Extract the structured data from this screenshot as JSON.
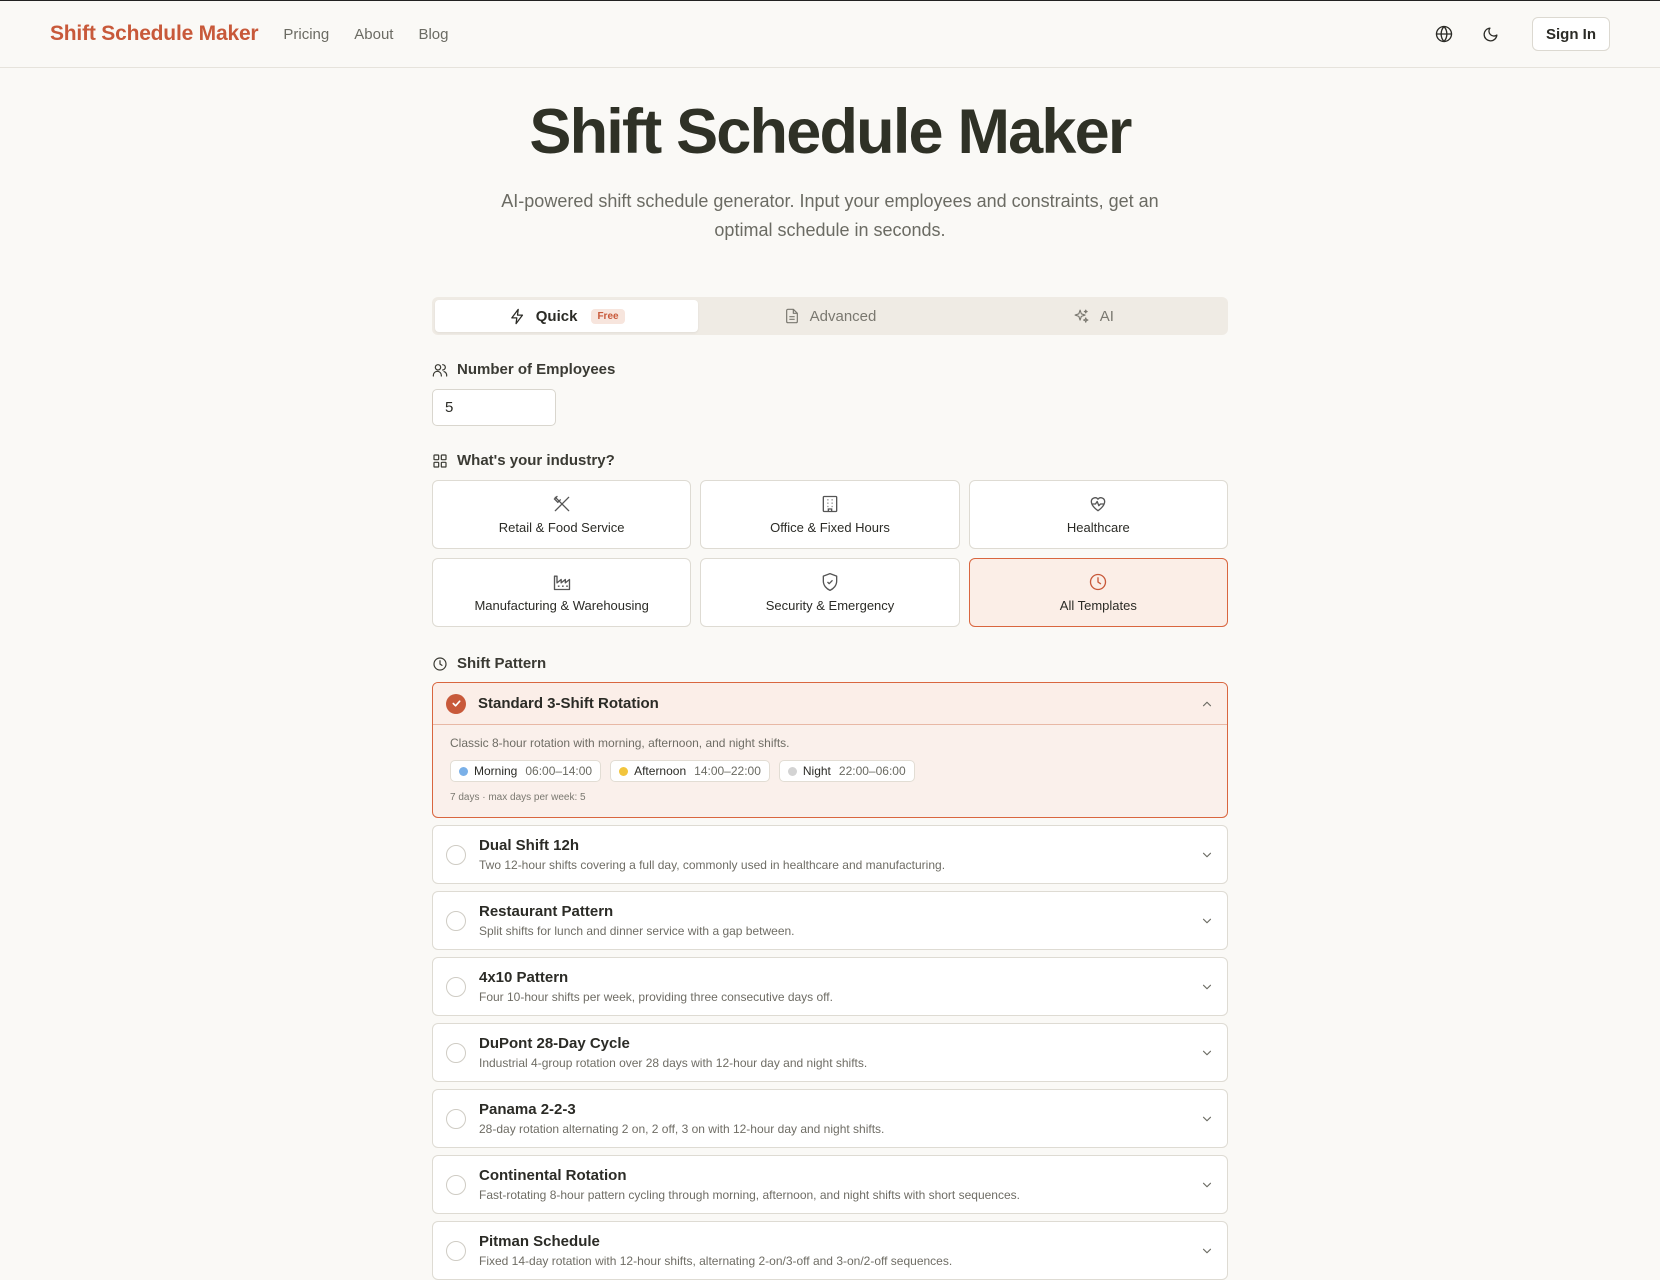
{
  "header": {
    "brand": "Shift Schedule Maker",
    "nav": [
      "Pricing",
      "About",
      "Blog"
    ],
    "sign_in": "Sign In"
  },
  "hero": {
    "title": "Shift Schedule Maker",
    "subtitle": "AI-powered shift schedule generator. Input your employees and constraints, get an optimal schedule in seconds."
  },
  "tabs": {
    "quick": "Quick",
    "free_badge": "Free",
    "advanced": "Advanced",
    "ai": "AI"
  },
  "employees": {
    "label": "Number of Employees",
    "value": "5"
  },
  "industry": {
    "label": "What's your industry?",
    "items": [
      {
        "label": "Retail & Food Service",
        "icon": "utensils-icon"
      },
      {
        "label": "Office & Fixed Hours",
        "icon": "building-icon"
      },
      {
        "label": "Healthcare",
        "icon": "heart-pulse-icon"
      },
      {
        "label": "Manufacturing & Warehousing",
        "icon": "factory-icon"
      },
      {
        "label": "Security & Emergency",
        "icon": "shield-icon"
      },
      {
        "label": "All Templates",
        "icon": "clock-icon"
      }
    ],
    "selected": "All Templates"
  },
  "pattern": {
    "label": "Shift Pattern",
    "selected": {
      "title": "Standard 3-Shift Rotation",
      "desc": "Classic 8-hour rotation with morning, afternoon, and night shifts.",
      "shifts": [
        {
          "name": "Morning",
          "time": "06:00–14:00",
          "color": "#7ab0e8"
        },
        {
          "name": "Afternoon",
          "time": "14:00–22:00",
          "color": "#f2c53d"
        },
        {
          "name": "Night",
          "time": "22:00–06:00",
          "color": "#d3d3d3"
        }
      ],
      "meta": "7 days · max days per week: 5"
    },
    "options": [
      {
        "title": "Dual Shift 12h",
        "desc": "Two 12-hour shifts covering a full day, commonly used in healthcare and manufacturing."
      },
      {
        "title": "Restaurant Pattern",
        "desc": "Split shifts for lunch and dinner service with a gap between."
      },
      {
        "title": "4x10 Pattern",
        "desc": "Four 10-hour shifts per week, providing three consecutive days off."
      },
      {
        "title": "DuPont 28-Day Cycle",
        "desc": "Industrial 4-group rotation over 28 days with 12-hour day and night shifts."
      },
      {
        "title": "Panama 2-2-3",
        "desc": "28-day rotation alternating 2 on, 2 off, 3 on with 12-hour day and night shifts."
      },
      {
        "title": "Continental Rotation",
        "desc": "Fast-rotating 8-hour pattern cycling through morning, afternoon, and night shifts with short sequences."
      },
      {
        "title": "Pitman Schedule",
        "desc": "Fixed 14-day rotation with 12-hour shifts, alternating 2-on/3-off and 3-on/2-off sequences."
      }
    ]
  },
  "colors": {
    "accent": "#c8593a",
    "accent_border": "#d9663f",
    "background": "#faf9f6"
  }
}
